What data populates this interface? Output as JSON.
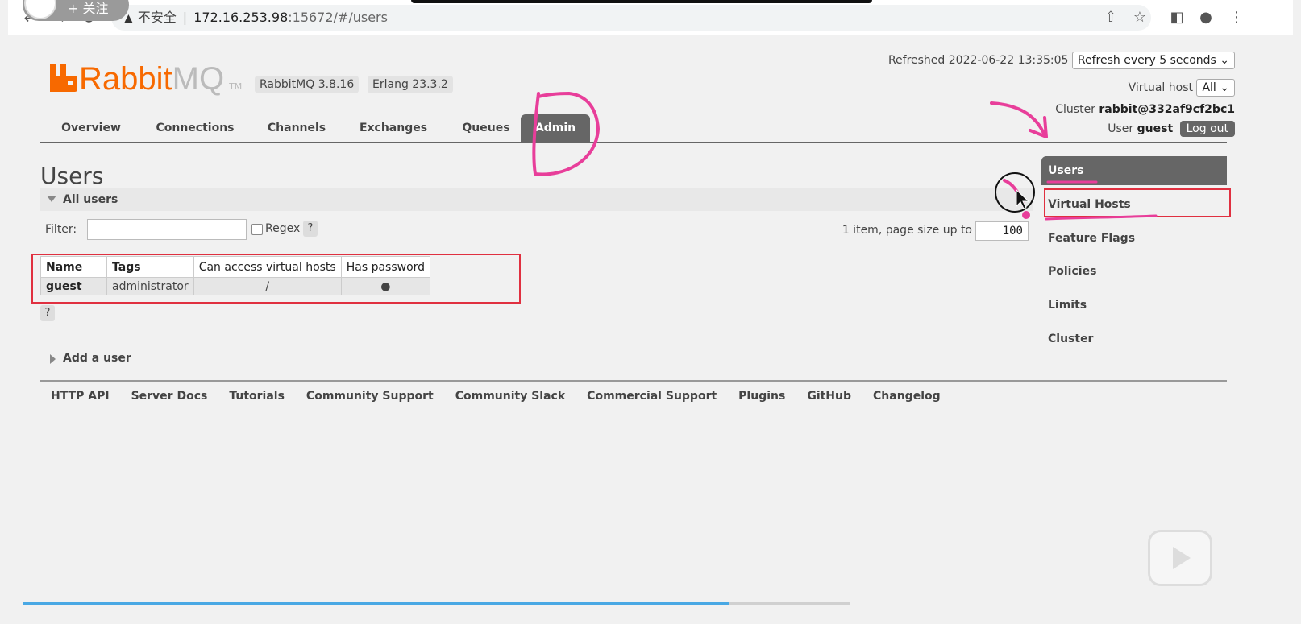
{
  "browser": {
    "url_insecure": "不安全",
    "url_host": "172.16.253.98",
    "url_path": ":15672/#/users",
    "follow_label": "+ 关注"
  },
  "header": {
    "logo_rabbit": "Rabbit",
    "logo_mq": "MQ",
    "logo_tm": "TM",
    "version_rabbitmq": "RabbitMQ 3.8.16",
    "version_erlang": "Erlang 23.3.2",
    "refreshed_label": "Refreshed 2022-06-22 13:35:05",
    "refresh_select": "Refresh every 5 seconds",
    "virtual_host_label": "Virtual host",
    "virtual_host_select": "All",
    "cluster_label": "Cluster",
    "cluster_name": "rabbit@332af9cf2bc1",
    "user_label": "User",
    "user_name": "guest",
    "logout_label": "Log out"
  },
  "tabs": [
    {
      "label": "Overview"
    },
    {
      "label": "Connections"
    },
    {
      "label": "Channels"
    },
    {
      "label": "Exchanges"
    },
    {
      "label": "Queues"
    },
    {
      "label": "Admin",
      "active": true
    }
  ],
  "sidebar": [
    {
      "label": "Users",
      "active": true
    },
    {
      "label": "Virtual Hosts"
    },
    {
      "label": "Feature Flags"
    },
    {
      "label": "Policies"
    },
    {
      "label": "Limits"
    },
    {
      "label": "Cluster"
    }
  ],
  "main": {
    "title": "Users",
    "section_title": "All users",
    "filter_label": "Filter:",
    "regex_label": "Regex",
    "help_label": "?",
    "pager_label": "1 item, page size up to",
    "page_size": "100",
    "table": {
      "headers": [
        "Name",
        "Tags",
        "Can access virtual hosts",
        "Has password"
      ],
      "rows": [
        {
          "name": "guest",
          "tags": "administrator",
          "vhosts": "/",
          "has_password": "●"
        }
      ]
    },
    "add_user_label": "Add a user"
  },
  "footer": {
    "links": [
      "HTTP API",
      "Server Docs",
      "Tutorials",
      "Community Support",
      "Community Slack",
      "Commercial Support",
      "Plugins",
      "GitHub",
      "Changelog"
    ]
  },
  "video": {
    "progress_fraction": 0.855
  },
  "colors": {
    "brand_orange": "#f76900",
    "tab_active": "#666666",
    "annotation_pink": "#e83e9a",
    "highlight_red": "#e03040",
    "progress_blue": "#49a8e4"
  }
}
